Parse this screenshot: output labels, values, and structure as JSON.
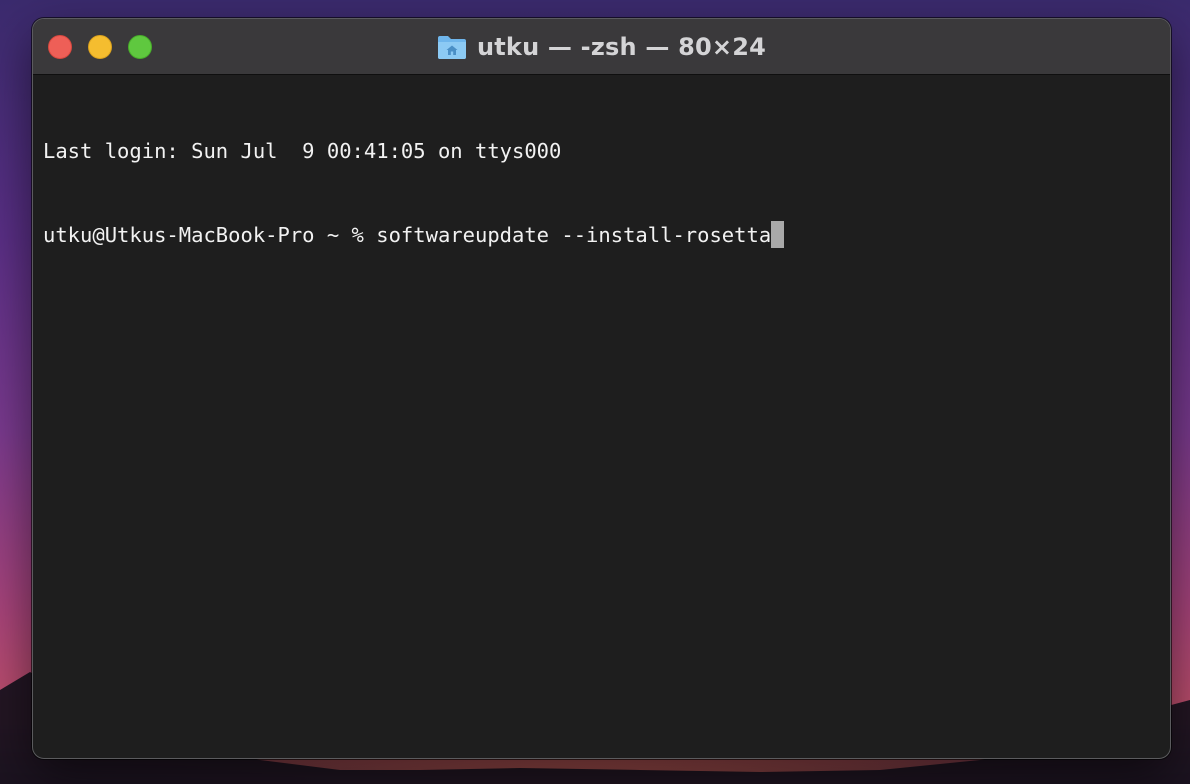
{
  "window": {
    "title": "utku — -zsh — 80×24",
    "folder_icon": "home-folder-icon",
    "traffic_lights": {
      "close_color": "#ee5f57",
      "minimize_color": "#f5bd2f",
      "zoom_color": "#5fc83f"
    }
  },
  "terminal": {
    "background": "#1e1e1e",
    "foreground": "#f2f2f2",
    "lines": [
      "Last login: Sun Jul  9 00:41:05 on ttys000",
      "utku@Utkus-MacBook-Pro ~ % softwareupdate --install-rosetta"
    ],
    "cursor_style": "block"
  }
}
